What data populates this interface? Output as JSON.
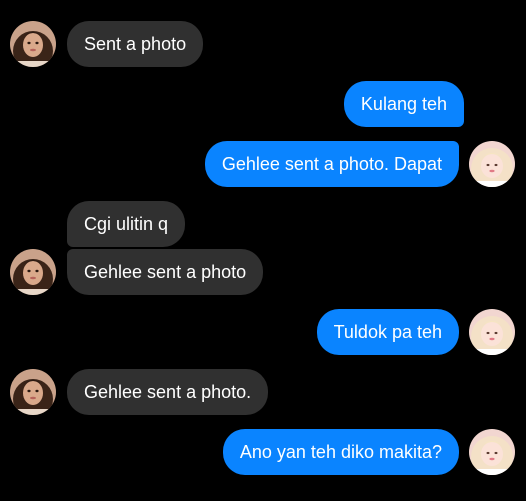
{
  "conversation": {
    "messages": [
      {
        "direction": "incoming",
        "text": "Sent a photo"
      },
      {
        "direction": "outgoing",
        "text": "Kulang teh"
      },
      {
        "direction": "outgoing",
        "text": "Gehlee sent a photo. Dapat"
      },
      {
        "direction": "incoming",
        "text": "Cgi ulitin q"
      },
      {
        "direction": "incoming",
        "text": "Gehlee sent a photo"
      },
      {
        "direction": "outgoing",
        "text": "Tuldok pa teh"
      },
      {
        "direction": "incoming",
        "text": "Gehlee sent a photo."
      },
      {
        "direction": "outgoing",
        "text": "Ano yan teh diko makita?"
      }
    ]
  },
  "colors": {
    "background": "#000000",
    "incoming_bubble": "#303030",
    "outgoing_bubble": "#0a84ff",
    "text": "#ffffff"
  },
  "icons": {
    "incoming_avatar": "contact-avatar-photo",
    "outgoing_avatar": "self-avatar-photo"
  }
}
